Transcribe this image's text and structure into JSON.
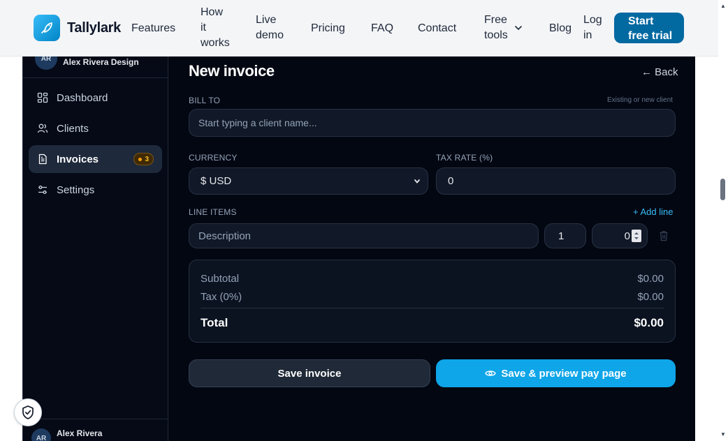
{
  "nav": {
    "brand": "Tallylark",
    "links": [
      "Features",
      "How\nit\nworks",
      "Live\ndemo",
      "Pricing",
      "FAQ",
      "Contact",
      "Free\ntools",
      "Blog",
      "Log\nin"
    ],
    "cta": "Start\nfree trial"
  },
  "sidebar": {
    "account_initials": "AR",
    "account_name": "Alex Rivera Design",
    "items": [
      {
        "label": "Dashboard",
        "icon": "dashboard-icon"
      },
      {
        "label": "Clients",
        "icon": "users-icon"
      },
      {
        "label": "Invoices",
        "icon": "invoice-icon",
        "badge": "3",
        "active": true
      },
      {
        "label": "Settings",
        "icon": "sliders-icon"
      }
    ],
    "user_initials": "AR",
    "user_name": "Alex Rivera"
  },
  "main": {
    "title": "New invoice",
    "back": "Back",
    "bill_to_label": "BILL TO",
    "bill_to_hint": "Existing or new client",
    "bill_to_placeholder": "Start typing a client name...",
    "currency_label": "CURRENCY",
    "currency_value": "$ USD",
    "tax_label": "TAX RATE (%)",
    "tax_value": "0",
    "line_items_label": "LINE ITEMS",
    "add_line": "Add line",
    "line_item": {
      "description_placeholder": "Description",
      "qty": "1",
      "price": "0"
    },
    "summary": {
      "subtotal_label": "Subtotal",
      "subtotal": "$0.00",
      "tax_label": "Tax (0%)",
      "tax": "$0.00",
      "total_label": "Total",
      "total": "$0.00"
    },
    "save_button": "Save invoice",
    "preview_button": "Save & preview pay page"
  },
  "colors": {
    "accent": "#0ea5e9",
    "cta": "#0369a1",
    "background": "#030712",
    "badge": "#f59e0b"
  }
}
